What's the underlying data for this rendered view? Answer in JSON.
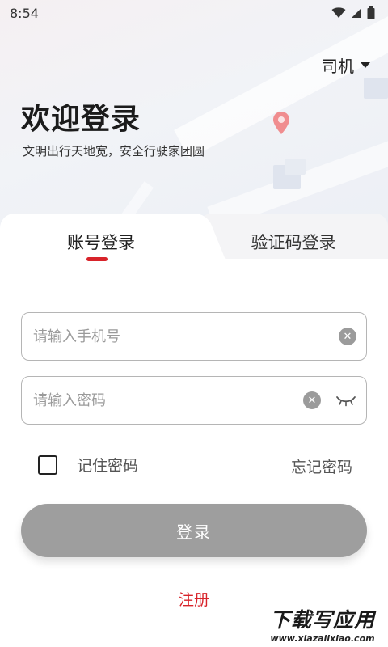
{
  "status_bar": {
    "time": "8:54"
  },
  "role_selector": {
    "label": "司机"
  },
  "welcome": {
    "title": "欢迎登录",
    "subtitle": "文明出行天地宽，安全行驶家团圆"
  },
  "tabs": [
    {
      "label": "账号登录",
      "active": true
    },
    {
      "label": "验证码登录",
      "active": false
    }
  ],
  "form": {
    "phone_placeholder": "请输入手机号",
    "password_placeholder": "请输入密码",
    "remember_label": "记住密码",
    "forgot_label": "忘记密码",
    "login_label": "登录",
    "register_label": "注册"
  },
  "watermark": {
    "title": "下载写应用",
    "url": "www.xiazaiixiao.com"
  },
  "colors": {
    "accent": "#d8232a",
    "button_disabled": "#9e9e9e"
  }
}
